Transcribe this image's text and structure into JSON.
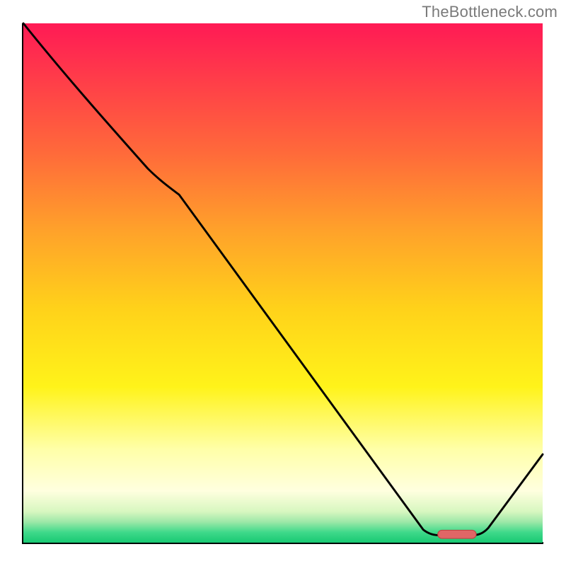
{
  "watermark": "TheBottleneck.com",
  "chart_data": {
    "type": "line",
    "title": "",
    "xlabel": "",
    "ylabel": "",
    "xlim": [
      0,
      100
    ],
    "ylim": [
      0,
      100
    ],
    "note": "Axes carry no tick labels in the source image; x and y values below are read as percent-of-axis positions.",
    "series": [
      {
        "name": "bottleneck-curve",
        "x": [
          0,
          5,
          10,
          15,
          20,
          24,
          30,
          40,
          50,
          60,
          70,
          77,
          80,
          83,
          86,
          89,
          100
        ],
        "values": [
          100,
          94,
          88,
          81,
          74,
          68,
          62,
          49,
          35,
          22,
          9,
          2.5,
          1.4,
          1.4,
          1.4,
          2.8,
          17
        ]
      }
    ],
    "annotations": [
      {
        "name": "valley-marker",
        "shape": "rounded-bar",
        "color": "#e06666",
        "x_range": [
          80,
          87
        ],
        "y": 1.4
      }
    ],
    "background_gradient_stops": [
      {
        "pos": 0.0,
        "color": "#ff1a55"
      },
      {
        "pos": 0.25,
        "color": "#ff6a3a"
      },
      {
        "pos": 0.55,
        "color": "#ffd21a"
      },
      {
        "pos": 0.82,
        "color": "#ffffa8"
      },
      {
        "pos": 0.96,
        "color": "#9de8a8"
      },
      {
        "pos": 1.0,
        "color": "#18c973"
      }
    ]
  }
}
